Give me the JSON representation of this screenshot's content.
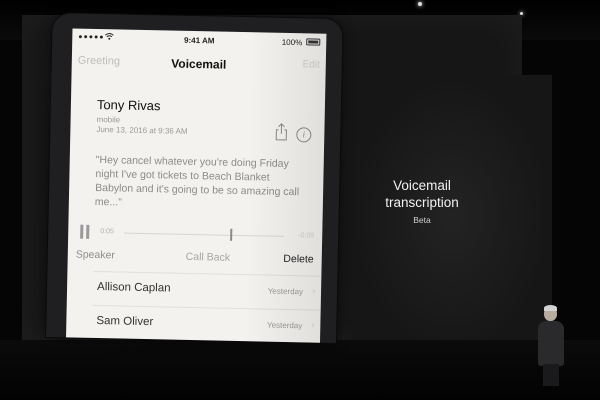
{
  "status_bar": {
    "signal": "●●●●●",
    "time": "9:41 AM",
    "battery": "100%"
  },
  "nav": {
    "back_label": "Greeting",
    "title": "Voicemail",
    "edit_label": "Edit"
  },
  "voicemail_detail": {
    "caller_name": "Tony Rivas",
    "caller_type": "mobile",
    "date": "June 13, 2016 at 9:36 AM",
    "transcript": "\"Hey cancel whatever you're doing Friday night I've got tickets to Beach Blanket Babylon and it's going to be so amazing call me...\"",
    "elapsed": "0:05",
    "remaining": "-0:09",
    "playback_progress": 0.66,
    "actions": {
      "speaker": "Speaker",
      "call_back": "Call Back",
      "delete": "Delete"
    }
  },
  "voicemail_list": [
    {
      "name": "Allison Caplan",
      "date": "Yesterday"
    },
    {
      "name": "Sam Oliver",
      "date": "Yesterday"
    }
  ],
  "slide": {
    "title": "Voicemail transcription",
    "subtitle": "Beta"
  },
  "icons": {
    "share": "share-icon",
    "info": "info-icon",
    "pause": "pause-icon",
    "wifi": "wifi-icon",
    "battery": "battery-icon"
  }
}
